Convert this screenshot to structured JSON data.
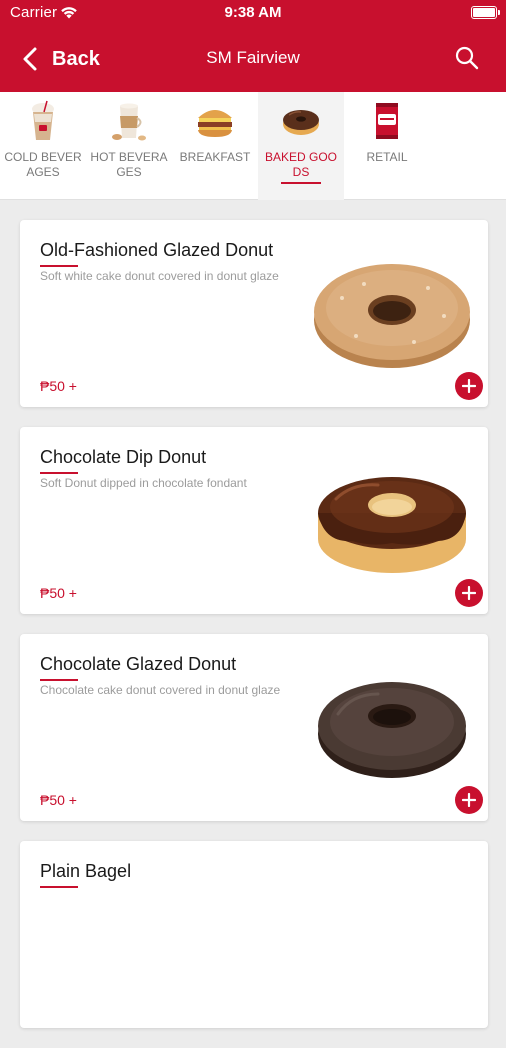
{
  "status_bar": {
    "carrier": "Carrier",
    "time": "9:38 AM"
  },
  "nav": {
    "back_label": "Back",
    "title": "SM Fairview"
  },
  "categories": [
    {
      "label": "COLD BEVERAGES",
      "icon": "iced-coffee-cup-icon"
    },
    {
      "label": "HOT BEVERAGES",
      "icon": "hot-latte-cup-icon"
    },
    {
      "label": "BREAKFAST",
      "icon": "breakfast-sandwich-icon"
    },
    {
      "label": "BAKED GOODS",
      "icon": "donut-icon",
      "selected": true
    },
    {
      "label": "RETAIL",
      "icon": "coffee-can-icon"
    }
  ],
  "products": [
    {
      "name": "Old-Fashioned Glazed Donut",
      "description": "Soft white cake donut covered in donut glaze",
      "price": "₱50 +"
    },
    {
      "name": "Chocolate Dip Donut",
      "description": "Soft Donut dipped in chocolate fondant",
      "price": "₱50 +"
    },
    {
      "name": "Chocolate Glazed Donut",
      "description": "Chocolate cake donut covered in donut glaze",
      "price": "₱50 +"
    },
    {
      "name": "Plain Bagel",
      "description": "",
      "price": ""
    }
  ],
  "colors": {
    "brand_red": "#c8102e",
    "background": "#ececec"
  }
}
